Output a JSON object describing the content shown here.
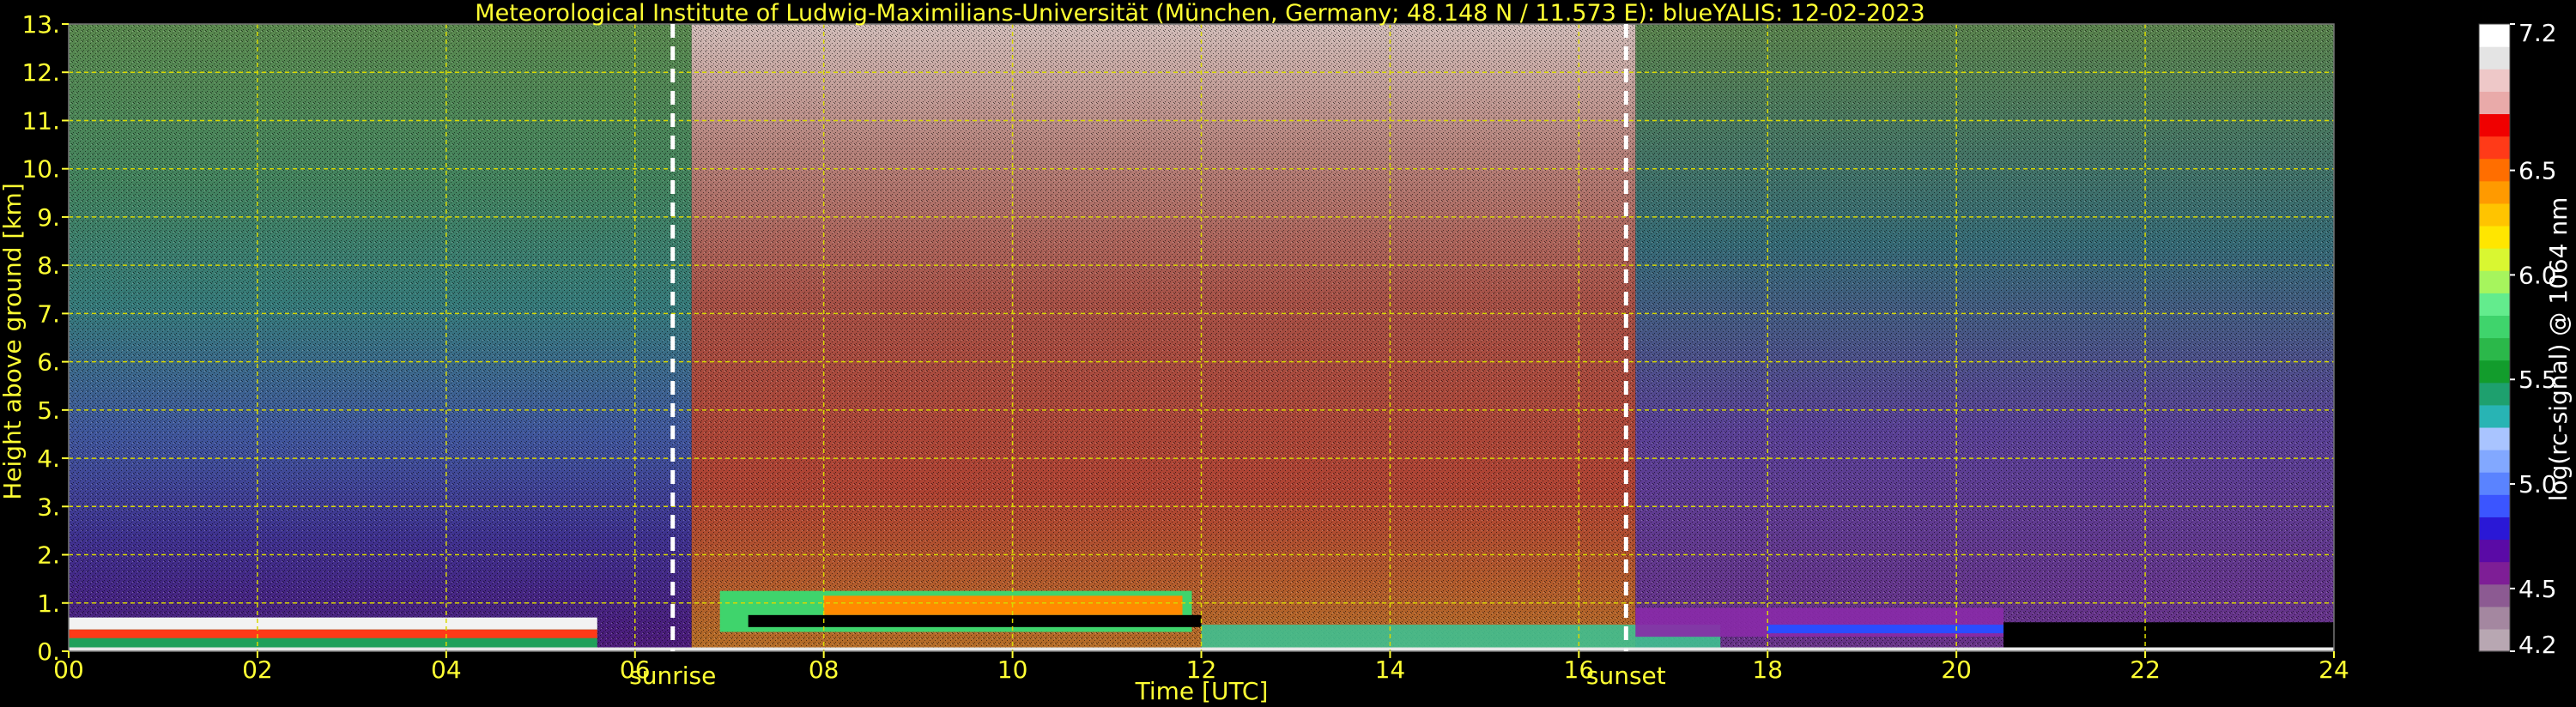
{
  "chart_data": {
    "type": "heatmap",
    "title": "Meteorological Institute of Ludwig-Maximilians-Universität (München, Germany; 48.148 N / 11.573 E):     blueYALIS: 12-02-2023",
    "xlabel": "Time [UTC]",
    "ylabel": "Height above ground [km]",
    "xlim": [
      0,
      24
    ],
    "ylim": [
      0,
      13
    ],
    "x_ticks": [
      "00",
      "02",
      "04",
      "06",
      "08",
      "10",
      "12",
      "14",
      "16",
      "18",
      "20",
      "22",
      "24"
    ],
    "y_ticks": [
      "0.",
      "1.",
      "2.",
      "3.",
      "4.",
      "5.",
      "6.",
      "7.",
      "8.",
      "9.",
      "10.",
      "11.",
      "12.",
      "13."
    ],
    "grid": true,
    "markers": [
      {
        "label": "sunrise",
        "x": 6.4
      },
      {
        "label": "sunset",
        "x": 16.5
      }
    ],
    "colorbar": {
      "label": "log(rc-signal) @ 1064 nm",
      "range": [
        4.2,
        7.2
      ],
      "ticks": [
        "7.2",
        "6.5",
        "6.0",
        "5.5",
        "5.0",
        "4.5",
        "4.2"
      ],
      "tick_values": [
        7.2,
        6.5,
        6.0,
        5.5,
        5.0,
        4.5,
        4.2
      ],
      "colors": [
        "#b8a7b2",
        "#a487a0",
        "#8c5a92",
        "#7e1e96",
        "#5a0aa6",
        "#2a18d6",
        "#3b55ff",
        "#5a83ff",
        "#82a8ff",
        "#a9c4ff",
        "#28b4b4",
        "#1ea06e",
        "#129c2c",
        "#2bb84a",
        "#3fd46c",
        "#63ec8d",
        "#a6f55d",
        "#d9f731",
        "#ffe600",
        "#ffc400",
        "#ff9a00",
        "#ff6e00",
        "#ff3a18",
        "#f00000",
        "#e9aaa9",
        "#eec8c8",
        "#e4e4e4",
        "#ffffff"
      ]
    }
  }
}
